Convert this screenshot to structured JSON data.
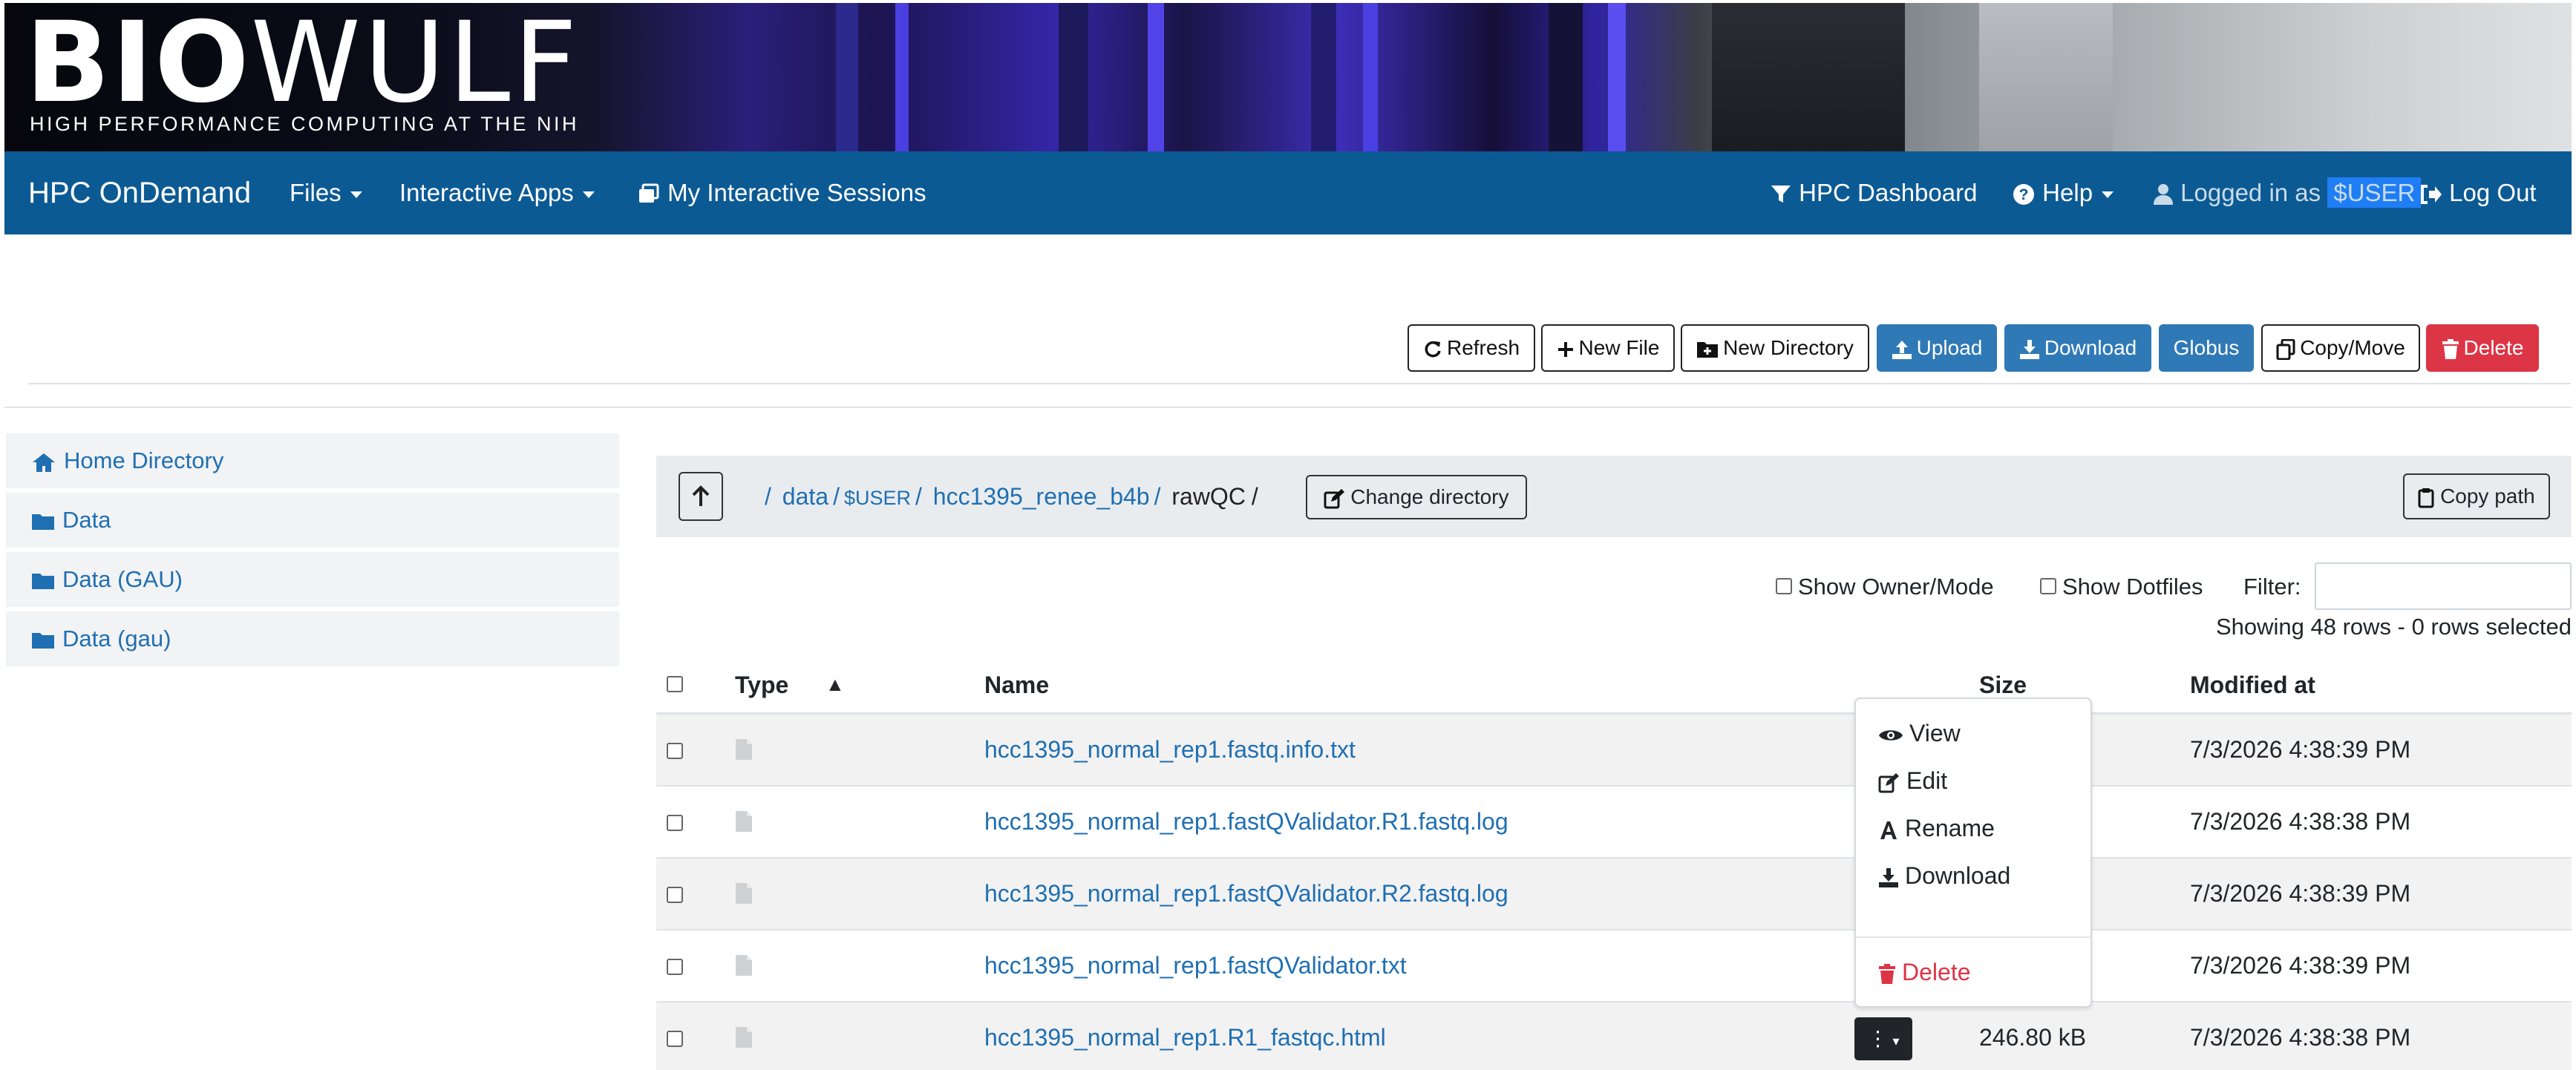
{
  "banner": {
    "logo_bold": "BIO",
    "logo_light": "WULF",
    "subtitle": "HIGH PERFORMANCE COMPUTING AT THE NIH"
  },
  "navbar": {
    "brand": "HPC OnDemand",
    "files": "Files",
    "interactive_apps": "Interactive Apps",
    "my_sessions": "My Interactive Sessions",
    "dashboard": "HPC Dashboard",
    "help": "Help",
    "logged_in_as": "Logged in as",
    "user": "$USER",
    "logout": "Log Out"
  },
  "toolbar": {
    "refresh": "Refresh",
    "new_file": "New File",
    "new_directory": "New Directory",
    "upload": "Upload",
    "download": "Download",
    "globus": "Globus",
    "copy_move": "Copy/Move",
    "delete": "Delete"
  },
  "sidebar": {
    "items": [
      {
        "label": "Home Directory",
        "icon": "home-icon"
      },
      {
        "label": "Data",
        "icon": "folder-icon"
      },
      {
        "label": "Data (GAU)",
        "icon": "folder-icon"
      },
      {
        "label": "Data (gau)",
        "icon": "folder-icon"
      }
    ]
  },
  "breadcrumb": {
    "sep": "/",
    "data": "data",
    "user": "$USER",
    "project": "hcc1395_renee_b4b",
    "current": "rawQC",
    "change_directory": "Change directory",
    "copy_path": "Copy path"
  },
  "options": {
    "show_owner": "Show Owner/Mode",
    "show_dotfiles": "Show Dotfiles",
    "filter_label": "Filter:",
    "filter_value": "",
    "showing": "Showing 48 rows - 0 rows selected"
  },
  "table": {
    "headers": {
      "type": "Type",
      "sort_indicator": "▲",
      "name": "Name",
      "size": "Size",
      "modified": "Modified at"
    },
    "rows": [
      {
        "name": "hcc1395_normal_rep1.fastq.info.txt",
        "size": "",
        "modified": "7/3/2026 4:38:39 PM"
      },
      {
        "name": "hcc1395_normal_rep1.fastQValidator.R1.fastq.log",
        "size": "",
        "modified": "7/3/2026 4:38:38 PM"
      },
      {
        "name": "hcc1395_normal_rep1.fastQValidator.R2.fastq.log",
        "size": "",
        "modified": "7/3/2026 4:38:39 PM"
      },
      {
        "name": "hcc1395_normal_rep1.fastQValidator.txt",
        "size": "",
        "modified": "7/3/2026 4:38:39 PM"
      },
      {
        "name": "hcc1395_normal_rep1.R1_fastqc.html",
        "size": "246.80 kB",
        "modified": "7/3/2026 4:38:38 PM"
      }
    ]
  },
  "menu": {
    "view": "View",
    "edit": "Edit",
    "rename": "Rename",
    "download": "Download",
    "delete": "Delete"
  },
  "colors": {
    "navbar": "#0c5a94",
    "link": "#1f6fb2",
    "primary_button": "#2f79b6",
    "danger": "#dc3545"
  }
}
